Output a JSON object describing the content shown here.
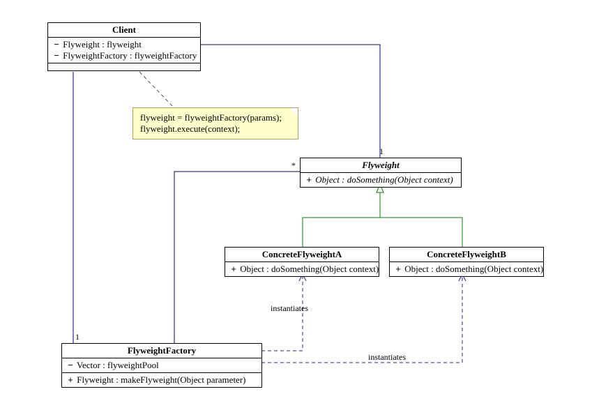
{
  "classes": {
    "client": {
      "name": "Client",
      "attrs": [
        {
          "vis": "−",
          "text": "Flyweight : flyweight"
        },
        {
          "vis": "−",
          "text": "FlyweightFactory : flyweightFactory"
        }
      ]
    },
    "flyweight": {
      "name": "Flyweight",
      "ops": [
        {
          "vis": "+",
          "text": "Object : doSomething(Object context)"
        }
      ]
    },
    "concreteA": {
      "name": "ConcreteFlyweightA",
      "ops": [
        {
          "vis": "+",
          "text": "Object : doSomething(Object context)"
        }
      ]
    },
    "concreteB": {
      "name": "ConcreteFlyweightB",
      "ops": [
        {
          "vis": "+",
          "text": "Object : doSomething(Object context)"
        }
      ]
    },
    "factory": {
      "name": "FlyweightFactory",
      "attrs": [
        {
          "vis": "−",
          "text": "Vector : flyweightPool"
        }
      ],
      "ops": [
        {
          "vis": "+",
          "text": "Flyweight : makeFlyweight(Object parameter)"
        }
      ]
    }
  },
  "note": {
    "line1": "flyweight = flyweightFactory(params);",
    "line2": "flyweight.execute(context);"
  },
  "labels": {
    "instantiates1": "instantiates",
    "instantiates2": "instantiates",
    "mult_star": "*",
    "mult_one_top": "1",
    "mult_one_bottom": "1"
  }
}
